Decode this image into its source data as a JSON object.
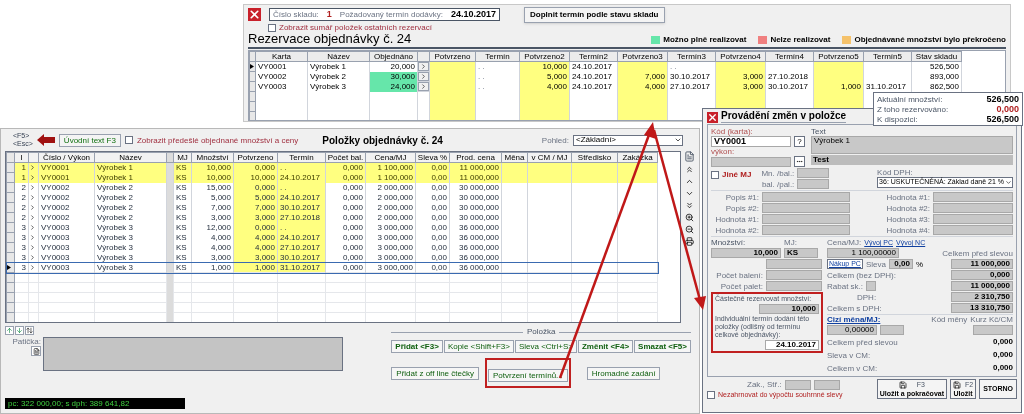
{
  "reservation_window": {
    "warehouse_label": "Číslo skladu:",
    "warehouse_number": "1",
    "due_date_label": "Požadovaný termín dodávky:",
    "due_date": "24.10.2017",
    "fill_button": "Doplnit termín podle stavu skladu",
    "summary_option": {
      "label": "Zobrazit sumář položek ostatních rezervací",
      "checked": false
    },
    "title": "Rezervace objednávky č. 24",
    "legend": [
      {
        "label": "Možno plně realizovat",
        "color": "#66e6aa"
      },
      {
        "label": "Nelze realizovat",
        "color": "#f08080"
      },
      {
        "label": "Objednávané množství bylo překročeno",
        "color": "#f5c26b"
      }
    ],
    "columns": [
      {
        "label": "Karta",
        "kind": "text"
      },
      {
        "label": "Název",
        "kind": "text"
      },
      {
        "label": "Objednáno",
        "kind": "ordered"
      },
      {
        "label": "Potvrzeno",
        "kind": "confirmed"
      },
      {
        "label": "Termín",
        "kind": "date"
      },
      {
        "label": "Potvrzeno2",
        "kind": "confirmed"
      },
      {
        "label": "Termín2",
        "kind": "date"
      },
      {
        "label": "Potvrzeno3",
        "kind": "confirmed"
      },
      {
        "label": "Termín3",
        "kind": "date"
      },
      {
        "label": "Potvrzeno4",
        "kind": "confirmed"
      },
      {
        "label": "Termín4",
        "kind": "date"
      },
      {
        "label": "Potvrzeno5",
        "kind": "confirmed"
      },
      {
        "label": "Termín5",
        "kind": "date"
      },
      {
        "label": "Stav skladu",
        "kind": "number"
      }
    ],
    "rows": [
      {
        "selected": true,
        "fully_available": false,
        "cells": [
          "VY0001",
          "Výrobek 1",
          "20,000",
          null,
          ". .",
          "10,000",
          "24.10.2017",
          null,
          ". .",
          null,
          null,
          null,
          null,
          "526,500"
        ]
      },
      {
        "selected": false,
        "fully_available": true,
        "cells": [
          "VY0002",
          "Výrobek 2",
          "30,000",
          null,
          ". .",
          "5,000",
          "24.10.2017",
          "7,000",
          "30.10.2017",
          "3,000",
          "27.10.2018",
          null,
          null,
          "893,000"
        ]
      },
      {
        "selected": false,
        "fully_available": true,
        "cells": [
          "VY0003",
          "Výrobek 3",
          "24,000",
          null,
          ". .",
          "4,000",
          "24.10.2017",
          "4,000",
          "27.10.2017",
          "3,000",
          "30.10.2017",
          "1,000",
          "31.10.2017",
          "862,500"
        ]
      }
    ]
  },
  "items_window": {
    "shortcut_keys": [
      "<F5>",
      "<Esc>"
    ],
    "intro_button": "Úvodní text F3",
    "previous_option": {
      "label": "Zobrazit předešlé objednané množství a ceny",
      "checked": false
    },
    "title": "Položky objednávky č. 24",
    "view_label": "Pohled:",
    "view_value": "<Základní>",
    "columns": [
      {
        "label": "I",
        "kind": "number"
      },
      {
        "label": "Číslo / Výkon",
        "kind": "text"
      },
      {
        "label": "Název",
        "kind": "text"
      },
      {
        "label": "MJ",
        "kind": "text"
      },
      {
        "label": "Množství",
        "kind": "number"
      },
      {
        "label": "Potvrzeno",
        "kind": "confirmed"
      },
      {
        "label": "Termín",
        "kind": "confirmed_date"
      },
      {
        "label": "Počet bal.",
        "kind": "number"
      },
      {
        "label": "Cena/MJ",
        "kind": "number"
      },
      {
        "label": "Sleva %",
        "kind": "number"
      },
      {
        "label": "Prod. cena",
        "kind": "number"
      },
      {
        "label": "Měna",
        "kind": "text"
      },
      {
        "label": "v CM / MJ",
        "kind": "number"
      },
      {
        "label": "Středisko",
        "kind": "text"
      },
      {
        "label": "Zakázka",
        "kind": "text"
      }
    ],
    "rows": [
      {
        "selected": false,
        "highlighted": true,
        "cells": [
          "1",
          "VY0001",
          "Výrobek 1",
          "KS",
          "10,000",
          "0,000",
          ". .",
          "0,000",
          "1 100,000",
          "0,00",
          "11 000,000",
          null,
          null,
          null,
          null
        ]
      },
      {
        "selected": false,
        "highlighted": true,
        "cells": [
          "1",
          "VY0001",
          "Výrobek 1",
          "KS",
          "10,000",
          "10,000",
          "24.10.2017",
          "0,000",
          "1 100,000",
          "0,00",
          "11 000,000",
          null,
          null,
          null,
          null
        ]
      },
      {
        "selected": false,
        "highlighted": false,
        "cells": [
          "2",
          "VY0002",
          "Výrobek 2",
          "KS",
          "15,000",
          "0,000",
          ". .",
          "0,000",
          "2 000,000",
          "0,00",
          "30 000,000",
          null,
          null,
          null,
          null
        ]
      },
      {
        "selected": false,
        "highlighted": false,
        "cells": [
          "2",
          "VY0002",
          "Výrobek 2",
          "KS",
          "5,000",
          "5,000",
          "24.10.2017",
          "0,000",
          "2 000,000",
          "0,00",
          "30 000,000",
          null,
          null,
          null,
          null
        ]
      },
      {
        "selected": false,
        "highlighted": false,
        "cells": [
          "2",
          "VY0002",
          "Výrobek 2",
          "KS",
          "7,000",
          "7,000",
          "30.10.2017",
          "0,000",
          "2 000,000",
          "0,00",
          "30 000,000",
          null,
          null,
          null,
          null
        ]
      },
      {
        "selected": false,
        "highlighted": false,
        "cells": [
          "2",
          "VY0002",
          "Výrobek 2",
          "KS",
          "3,000",
          "3,000",
          "27.10.2018",
          "0,000",
          "2 000,000",
          "0,00",
          "30 000,000",
          null,
          null,
          null,
          null
        ]
      },
      {
        "selected": false,
        "highlighted": false,
        "cells": [
          "3",
          "VY0003",
          "Výrobek 3",
          "KS",
          "12,000",
          "0,000",
          ". .",
          "0,000",
          "3 000,000",
          "0,00",
          "36 000,000",
          null,
          null,
          null,
          null
        ]
      },
      {
        "selected": false,
        "highlighted": false,
        "cells": [
          "3",
          "VY0003",
          "Výrobek 3",
          "KS",
          "4,000",
          "4,000",
          "24.10.2017",
          "0,000",
          "3 000,000",
          "0,00",
          "36 000,000",
          null,
          null,
          null,
          null
        ]
      },
      {
        "selected": false,
        "highlighted": false,
        "cells": [
          "3",
          "VY0003",
          "Výrobek 3",
          "KS",
          "4,000",
          "4,000",
          "27.10.2017",
          "0,000",
          "3 000,000",
          "0,00",
          "36 000,000",
          null,
          null,
          null,
          null
        ]
      },
      {
        "selected": false,
        "highlighted": false,
        "cells": [
          "3",
          "VY0003",
          "Výrobek 3",
          "KS",
          "3,000",
          "3,000",
          "30.10.2017",
          "0,000",
          "3 000,000",
          "0,00",
          "36 000,000",
          null,
          null,
          null,
          null
        ]
      },
      {
        "selected": true,
        "highlighted": false,
        "cells": [
          "3",
          "VY0003",
          "Výrobek 3",
          "KS",
          "1,000",
          "1,000",
          "31.10.2017",
          "0,000",
          "3 000,000",
          "0,00",
          "36 000,000",
          null,
          null,
          null,
          null
        ]
      }
    ],
    "footer_label": "Patička:",
    "group_label": "Položka",
    "buttons": [
      {
        "label": "Přidat <F3>",
        "bold": true
      },
      {
        "label": "Kopie <Shift+F3>",
        "bold": false
      },
      {
        "label": "Sleva <Ctrl+S>",
        "bold": false
      },
      {
        "label": "Změnit <F4>",
        "bold": true
      },
      {
        "label": "Smazat <F5>",
        "bold": true
      }
    ],
    "buttons_row2": [
      {
        "label": "Přidat z off line čtečky",
        "highlighted": false
      },
      {
        "label": "Potvrzení termínů...",
        "highlighted": true
      },
      {
        "label": "Hromadné zadání",
        "highlighted": false
      }
    ],
    "status_text": "pc: 322 000,00; s dph: 389 641,82"
  },
  "edit_window": {
    "title": "Provádění změn v položce",
    "stock": [
      {
        "label": "Aktuální množství:",
        "value": "526,500",
        "kind": "normal"
      },
      {
        "label": "Z toho rezervováno:",
        "value": "0,000",
        "kind": "reserved"
      },
      {
        "label": "K dispozici:",
        "value": "526,500",
        "kind": "normal"
      }
    ],
    "code_label": "Kód (karta):",
    "code": "VY0001",
    "help_button": "?",
    "work_label": "výkon:",
    "text_label": "Text",
    "text_value": "Výrobek 1",
    "text_bar": "Test",
    "other_unit": {
      "label": "Jiné MJ",
      "checked": false
    },
    "per_pack_label": "Mn. /bal.:",
    "per_pallet_label": "bal. /pal.:",
    "vat_label": "Kód DPH:",
    "vat_value": "36: USKUTEČNĚNÁ: Základ daně 21 %",
    "params_left": [
      "Popis #1:",
      "Popis #2:",
      "Hodnota #1:",
      "Hodnota #2:"
    ],
    "params_right": [
      "Hodnota #1:",
      "Hodnota #2:",
      "Hodnota #3:",
      "Hodnota #4:"
    ],
    "quantity_label": "Množství:",
    "quantity": "10,000",
    "unit_label": "MJ:",
    "unit": "KS",
    "price_label": "Cena/MJ:",
    "price_links": [
      "Vývoj PC",
      "Vývoj NC"
    ],
    "price": "1 100,00000",
    "total_before_label": "Celkem před slevou",
    "total_before": "11 000,000",
    "purchase_button": "Nákup PC",
    "discount_label": "Sleva",
    "discount": "0,00",
    "percent": "%",
    "discount_amount": "0,000",
    "total_net_label": "Celkem (bez DPH):",
    "total_net": "11 000,000",
    "rebate_label": "Rabat sk.:",
    "vat_amount_label": "DPH:",
    "vat_amount": "2 310,750",
    "total_gross_label": "Celkem s DPH:",
    "total_gross": "13 310,750",
    "packs_label": "Počet balení:",
    "pallets_label": "Počet palet:",
    "partial_label": "Částečně rezervovat množství:",
    "partial": "10,000",
    "individual_label": "Individuální termín dodání této položky (odlišný od termínu celkové objednávky):",
    "individual_date": "24.10.2017",
    "foreign_label": "Cizí měna/MJ:",
    "foreign_price": "0,00000",
    "currency_label": "Kód měny",
    "rate_label": "Kurz Kč/CM",
    "foreign_total_before_label": "Celkem před slevou",
    "foreign_total_before": "0,000",
    "foreign_discount_label": "Sleva v CM:",
    "foreign_discount": "0,000",
    "foreign_total_label": "Celkem v CM:",
    "foreign_total": "0,000",
    "center_label": "Zak., Stř.:",
    "save_continue": {
      "label": "Uložit a pokračovat",
      "key": "F3"
    },
    "save": {
      "label": "Uložit",
      "key": "F2"
    },
    "cancel": "STORNO",
    "exclude_option": {
      "label": "Nezahrnovat do výpočtu souhrnné slevy",
      "checked": false
    }
  }
}
